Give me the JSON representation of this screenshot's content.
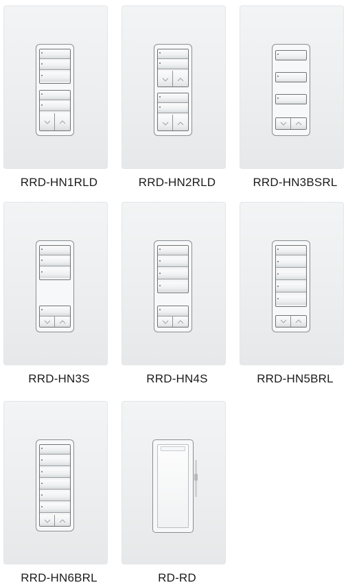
{
  "products": [
    {
      "model": "RRD-HN1RLD"
    },
    {
      "model": "RRD-HN2RLD"
    },
    {
      "model": "RRD-HN3BSRL"
    },
    {
      "model": "RRD-HN3S"
    },
    {
      "model": "RRD-HN4S"
    },
    {
      "model": "RRD-HN5BRL"
    },
    {
      "model": "RRD-HN6BRL"
    },
    {
      "model": "RD-RD"
    }
  ]
}
